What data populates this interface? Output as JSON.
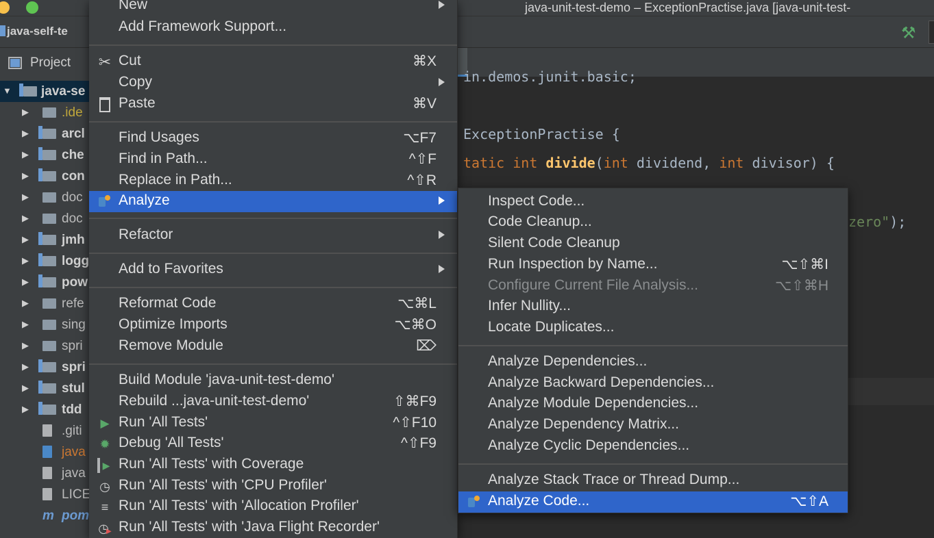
{
  "window": {
    "title": "java-unit-test-demo – ExceptionPractise.java [java-unit-test-"
  },
  "navbar": {
    "breadcrumb": "java-self-te"
  },
  "project_panel": {
    "title": "Project",
    "tree": [
      {
        "label": "java-se",
        "expanded": true,
        "selected": true
      },
      {
        "label": ".ide",
        "style": "yellow"
      },
      {
        "label": "arcl",
        "style": "bold"
      },
      {
        "label": "che",
        "style": "bold"
      },
      {
        "label": "con",
        "style": "bold"
      },
      {
        "label": "doc",
        "style": "normal"
      },
      {
        "label": "doc",
        "style": "normal"
      },
      {
        "label": "jmh",
        "style": "bold"
      },
      {
        "label": "logg",
        "style": "bold"
      },
      {
        "label": "pow",
        "style": "bold"
      },
      {
        "label": "refe",
        "style": "normal"
      },
      {
        "label": "sing",
        "style": "normal"
      },
      {
        "label": "spri",
        "style": "normal"
      },
      {
        "label": "spri",
        "style": "bold"
      },
      {
        "label": "stul",
        "style": "bold"
      },
      {
        "label": "tdd",
        "style": "bold"
      },
      {
        "label": ".giti",
        "style": "normal"
      },
      {
        "label": "java",
        "style": "orange"
      },
      {
        "label": "java",
        "style": "normal"
      },
      {
        "label": "LICE",
        "style": "normal"
      },
      {
        "label": "pom",
        "style": "m"
      }
    ]
  },
  "editor": {
    "lines": [
      "in.demos.junit.basic;",
      "ExceptionPractise {",
      "tatic int divide(int dividend, int divisor) {",
      "zero\");"
    ]
  },
  "context_menu": {
    "items": [
      {
        "label": "New",
        "submenu": true
      },
      {
        "label": "Add Framework Support..."
      },
      {
        "label": "Cut",
        "shortcut": "⌘X",
        "icon": "scissors-icon"
      },
      {
        "label": "Copy",
        "submenu": true
      },
      {
        "label": "Paste",
        "shortcut": "⌘V",
        "icon": "clipboard-icon"
      },
      {
        "label": "Find Usages",
        "shortcut": "⌥F7"
      },
      {
        "label": "Find in Path...",
        "shortcut": "^⇧F"
      },
      {
        "label": "Replace in Path...",
        "shortcut": "^⇧R"
      },
      {
        "label": "Analyze",
        "submenu": true,
        "selected": true,
        "icon": "analyze-icon"
      },
      {
        "label": "Refactor",
        "submenu": true
      },
      {
        "label": "Add to Favorites",
        "submenu": true
      },
      {
        "label": "Reformat Code",
        "shortcut": "⌥⌘L"
      },
      {
        "label": "Optimize Imports",
        "shortcut": "⌥⌘O"
      },
      {
        "label": "Remove Module",
        "shortcut": "⌦"
      },
      {
        "label": "Build Module 'java-unit-test-demo'"
      },
      {
        "label": "Rebuild ...java-unit-test-demo'",
        "shortcut": "⇧⌘F9"
      },
      {
        "label": "Run 'All Tests'",
        "shortcut": "^⇧F10",
        "icon": "run-icon"
      },
      {
        "label": "Debug 'All Tests'",
        "shortcut": "^⇧F9",
        "icon": "debug-icon"
      },
      {
        "label": "Run 'All Tests' with Coverage",
        "icon": "coverage-icon"
      },
      {
        "label": "Run 'All Tests' with 'CPU Profiler'",
        "icon": "cpu-profiler-icon"
      },
      {
        "label": "Run 'All Tests' with 'Allocation Profiler'",
        "icon": "allocation-profiler-icon"
      },
      {
        "label": "Run 'All Tests' with 'Java Flight Recorder'",
        "icon": "flight-recorder-icon"
      }
    ]
  },
  "analyze_submenu": {
    "items": [
      {
        "label": "Inspect Code..."
      },
      {
        "label": "Code Cleanup..."
      },
      {
        "label": "Silent Code Cleanup"
      },
      {
        "label": "Run Inspection by Name...",
        "shortcut": "⌥⇧⌘I"
      },
      {
        "label": "Configure Current File Analysis...",
        "shortcut": "⌥⇧⌘H",
        "disabled": true
      },
      {
        "label": "Infer Nullity..."
      },
      {
        "label": "Locate Duplicates..."
      },
      {
        "label": "Analyze Dependencies..."
      },
      {
        "label": "Analyze Backward Dependencies..."
      },
      {
        "label": "Analyze Module Dependencies..."
      },
      {
        "label": "Analyze Dependency Matrix..."
      },
      {
        "label": "Analyze Cyclic Dependencies..."
      },
      {
        "label": "Analyze Stack Trace or Thread Dump..."
      },
      {
        "label": "Analyze Code...",
        "shortcut": "⌥⇧A",
        "selected": true,
        "icon": "analyze-icon"
      }
    ]
  }
}
